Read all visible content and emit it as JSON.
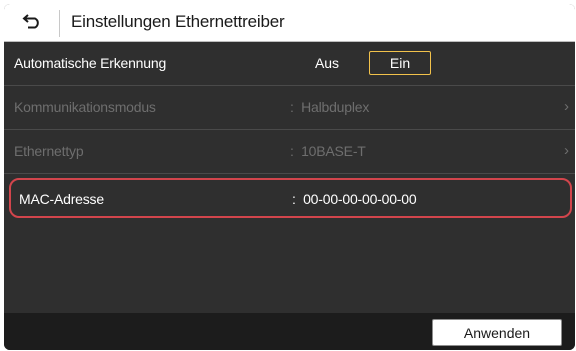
{
  "header": {
    "title": "Einstellungen Ethernettreiber",
    "back_icon": "back-arrow-icon"
  },
  "rows": {
    "auto_detect": {
      "label": "Automatische Erkennung",
      "options": [
        "Aus",
        "Ein"
      ],
      "selected": "Ein"
    },
    "comm_mode": {
      "label": "Kommunikationsmodus",
      "separator": ":",
      "value": "Halbduplex",
      "enabled": false
    },
    "eth_type": {
      "label": "Ethernettyp",
      "separator": ":",
      "value": "10BASE-T",
      "enabled": false
    },
    "mac": {
      "label": "MAC-Adresse",
      "separator": ":",
      "value": "00-00-00-00-00-00"
    }
  },
  "footer": {
    "apply_label": "Anwenden"
  },
  "colors": {
    "background": "#2f2f2f",
    "header": "#ffffff",
    "selected_border": "#f2c24b",
    "highlight_border": "#d2454c",
    "disabled_text": "#6e6e6e"
  }
}
